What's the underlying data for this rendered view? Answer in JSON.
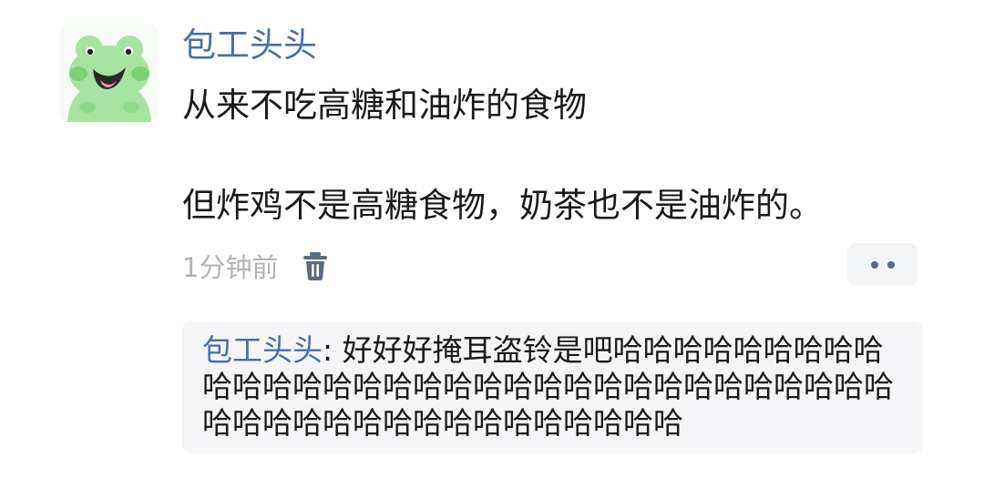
{
  "post": {
    "username": "包工头头",
    "avatar_icon": "green-frog-avatar-icon",
    "paragraphs": [
      "从来不吃高糖和油炸的食物",
      "但炸鸡不是高糖食物，奶茶也不是油炸的。"
    ],
    "timestamp": "1分钟前",
    "delete_icon": "trash-icon",
    "more_icon": "more-dots-icon"
  },
  "reply": {
    "author": "包工头头",
    "separator": ": ",
    "text": "好好好掩耳盗铃是吧哈哈哈哈哈哈哈哈哈哈哈哈哈哈哈哈哈哈哈哈哈哈哈哈哈哈哈哈哈哈哈哈哈哈哈哈哈哈哈哈哈哈哈哈哈哈哈哈"
  },
  "colors": {
    "username": "#4a6fa5",
    "body_text": "#1a1a1a",
    "timestamp": "#b3b3b3",
    "icon": "#5b6a84",
    "reply_background": "#f5f5f7",
    "avatar_green": "#8fd98a"
  }
}
